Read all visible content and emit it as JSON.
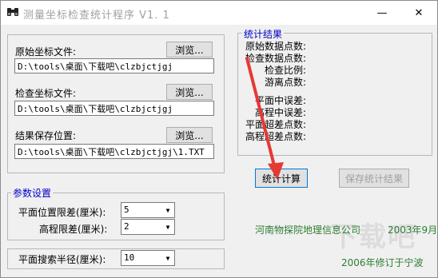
{
  "window": {
    "title": "测量坐标检查统计程序 V1. 1",
    "minimize": "—",
    "close": "✕"
  },
  "files": {
    "original_label": "原始坐标文件:",
    "original_value": "D:\\tools\\桌面\\下载吧\\clzbjctjgj",
    "check_label": "检查坐标文件:",
    "check_value": "D:\\tools\\桌面\\下载吧\\clzbjctjgj",
    "save_label": "结果保存位置:",
    "save_value": "D:\\tools\\桌面\\下载吧\\clzbjctjgj\\1.TXT",
    "browse_label": "浏览..."
  },
  "params": {
    "legend": "参数设置",
    "plane_label": "平面位置限差(厘米):",
    "plane_value": "5",
    "elev_label": "高程限差(厘米):",
    "elev_value": "2",
    "radius_label": "平面搜索半径(厘米):",
    "radius_value": "10"
  },
  "results": {
    "legend": "统计结果",
    "items": [
      "原始数据点数:",
      "检查数据点数:",
      "检查比例:",
      "游离点数:",
      "平面中误差:",
      "高程中误差:",
      "平面超差点数:",
      "高程超差点数:"
    ]
  },
  "actions": {
    "calc": "统计计算",
    "save": "保存统计结果"
  },
  "footer": {
    "org": "河南物探院地理信息公司",
    "date1": "2003年9月",
    "revised": "2006年修订于宁波"
  },
  "watermark": "下载吧"
}
